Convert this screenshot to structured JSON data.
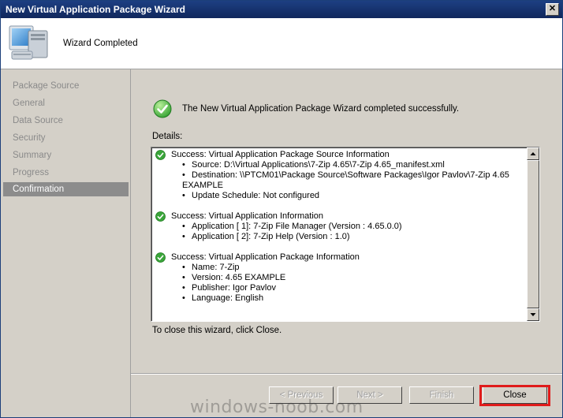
{
  "window": {
    "title": "New Virtual Application Package Wizard",
    "close_glyph": "✕"
  },
  "header": {
    "title": "Wizard Completed",
    "icon": "computer-icon"
  },
  "sidebar": {
    "items": [
      {
        "label": "Package Source"
      },
      {
        "label": "General"
      },
      {
        "label": "Data Source"
      },
      {
        "label": "Security"
      },
      {
        "label": "Summary"
      },
      {
        "label": "Progress"
      },
      {
        "label": "Confirmation",
        "active": true
      }
    ]
  },
  "main": {
    "success_message": "The New Virtual Application Package Wizard completed successfully.",
    "details_label": "Details:",
    "sections": [
      {
        "title": "Success: Virtual Application Package Source Information",
        "bullets": [
          "Source: D:\\Virtual Applications\\7-Zip 4.65\\7-Zip 4.65_manifest.xml",
          "Destination: \\\\PTCM01\\Package Source\\Software Packages\\Igor Pavlov\\7-Zip 4.65",
          "Update Schedule: Not configured"
        ],
        "continuation": "EXAMPLE"
      },
      {
        "title": "Success: Virtual Application Information",
        "bullets": [
          "Application [  1]: 7-Zip File Manager (Version : 4.65.0.0)",
          "Application [  2]: 7-Zip Help (Version : 1.0)"
        ]
      },
      {
        "title": "Success: Virtual Application Package Information",
        "bullets": [
          "Name: 7-Zip",
          "Version: 4.65 EXAMPLE",
          "Publisher: Igor Pavlov",
          "Language: English"
        ]
      }
    ],
    "close_hint": "To close this wizard, click Close."
  },
  "buttons": {
    "previous": "< Previous",
    "next": "Next >",
    "finish": "Finish",
    "close": "Close"
  },
  "watermark": "windows-noob.com",
  "colors": {
    "accent": "#1d3f82",
    "success": "#2e9e2e",
    "highlight": "#e01b1b"
  }
}
